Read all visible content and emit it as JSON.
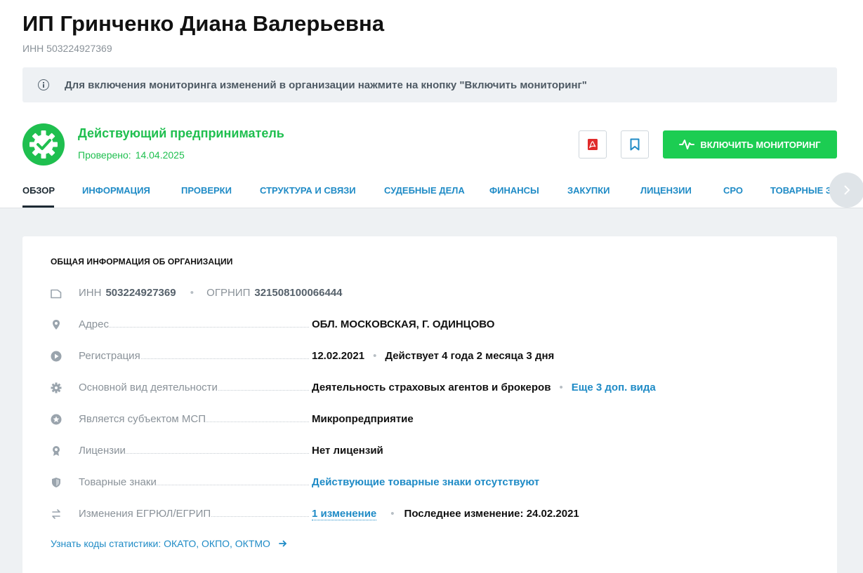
{
  "company": {
    "title": "ИП Гринченко Диана Валерьевна",
    "inn_line": "ИНН 503224927369"
  },
  "notice": {
    "icon": "info-icon",
    "text": "Для включения мониторинга изменений в организации нажмите на кнопку \"Включить мониторинг\""
  },
  "status": {
    "icon": "gear-check-icon",
    "label": "Действующий предприниматель",
    "checked_label": "Проверено:",
    "checked_date": "14.04.2025",
    "color": "#1fbf4f"
  },
  "actions": {
    "pdf_icon": "pdf-icon",
    "bookmark_icon": "bookmark-icon",
    "monitor_label": "ВКЛЮЧИТЬ МОНИТОРИНГ",
    "monitor_color": "#1ccd52"
  },
  "tabs": [
    {
      "label": "ОБЗОР",
      "active": true
    },
    {
      "label": "ИНФОРМАЦИЯ"
    },
    {
      "label": "ПРОВЕРКИ"
    },
    {
      "label": "СТРУКТУРА И СВЯЗИ"
    },
    {
      "label": "СУДЕБНЫЕ ДЕЛА"
    },
    {
      "label": "ФИНАНСЫ"
    },
    {
      "label": "ЗАКУПКИ"
    },
    {
      "label": "ЛИЦЕНЗИИ"
    },
    {
      "label": "СРО"
    },
    {
      "label": "ТОВАРНЫЕ ЗНАКИ"
    }
  ],
  "card": {
    "title": "ОБЩАЯ ИНФОРМАЦИЯ ОБ ОРГАНИЗАЦИИ",
    "inn_label": "ИНН",
    "inn_value": "503224927369",
    "ogrnip_label": "ОГРНИП",
    "ogrnip_value": "321508100066444",
    "rows": [
      {
        "icon": "map-pin-icon",
        "label": "Адрес",
        "value": "ОБЛ. МОСКОВСКАЯ, Г. ОДИНЦОВО"
      },
      {
        "icon": "play-circle-icon",
        "label": "Регистрация",
        "value": "12.02.2021",
        "extra": "Действует 4 года 2 месяца 3 дня"
      },
      {
        "icon": "gear-icon",
        "label": "Основной вид деятельности",
        "value": "Деятельность страховых агентов и брокеров",
        "link": "Еще 3 доп. вида"
      },
      {
        "icon": "star-badge-icon",
        "label": "Является субъектом МСП",
        "value": "Микропредприятие"
      },
      {
        "icon": "award-icon",
        "label": "Лицензии",
        "value": "Нет лицензий"
      },
      {
        "icon": "shield-icon",
        "label": "Товарные знаки",
        "link": "Действующие товарные знаки отсутствуют"
      },
      {
        "icon": "arrows-exchange-icon",
        "label": "Изменения ЕГРЮЛ/ЕГРИП",
        "link": "1 изменение",
        "extra_label": "Последнее изменение:",
        "extra_value": "24.02.2021"
      }
    ],
    "stat_link": "Узнать коды статистики:  ОКАТО, ОКПО, ОКТМО"
  }
}
